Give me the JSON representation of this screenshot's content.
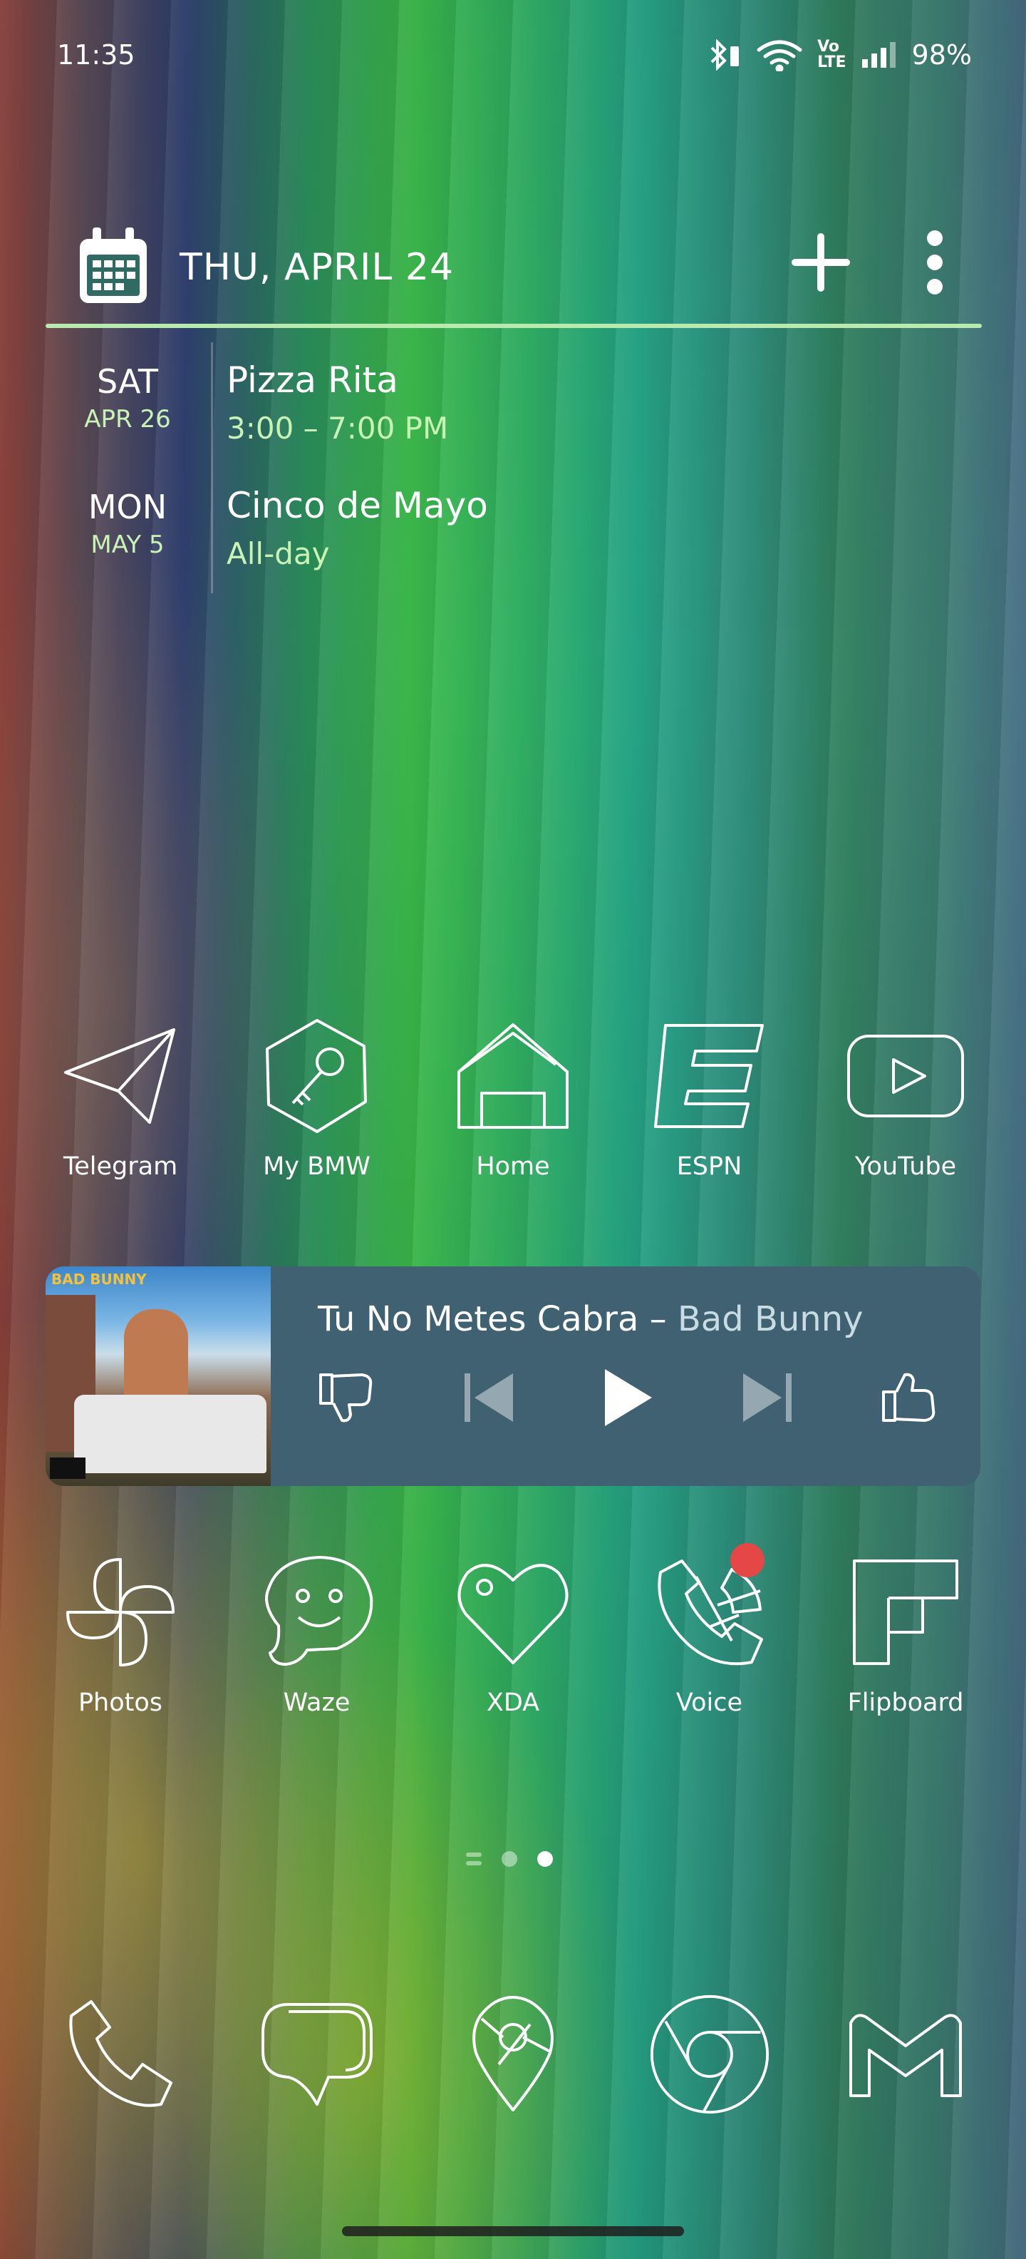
{
  "status_bar": {
    "time": "11:35",
    "lte_label_top": "Vo",
    "lte_label_bottom": "LTE",
    "battery": "98%"
  },
  "calendar": {
    "date_title": "THU, APRIL 24",
    "events": [
      {
        "dow": "SAT",
        "md": "APR 26",
        "name": "Pizza Rita",
        "time": "3:00 – 7:00 PM"
      },
      {
        "dow": "MON",
        "md": "MAY 5",
        "name": "Cinco de Mayo",
        "time": "All-day"
      }
    ]
  },
  "apps_row1": [
    {
      "label": "Telegram",
      "icon": "telegram-icon"
    },
    {
      "label": "My BMW",
      "icon": "key-icon"
    },
    {
      "label": "Home",
      "icon": "home-icon"
    },
    {
      "label": "ESPN",
      "icon": "espn-icon"
    },
    {
      "label": "YouTube",
      "icon": "youtube-icon"
    }
  ],
  "music": {
    "song": "Tu No Metes Cabra",
    "separator": " – ",
    "artist": "Bad Bunny",
    "cover_text": "BAD BUNNY"
  },
  "apps_row2": [
    {
      "label": "Photos",
      "icon": "pinwheel-icon"
    },
    {
      "label": "Waze",
      "icon": "waze-icon"
    },
    {
      "label": "XDA",
      "icon": "heart-icon"
    },
    {
      "label": "Voice",
      "icon": "voice-icon",
      "badge": true
    },
    {
      "label": "Flipboard",
      "icon": "flipboard-icon"
    }
  ],
  "dock": [
    {
      "icon": "phone-icon"
    },
    {
      "icon": "messages-icon"
    },
    {
      "icon": "maps-icon"
    },
    {
      "icon": "chrome-icon"
    },
    {
      "icon": "gmail-icon"
    }
  ],
  "colors": {
    "accent_line": "#b8eab0",
    "event_secondary": "#c9f2b5",
    "music_bg": "#3f6172",
    "badge": "#e54646"
  }
}
